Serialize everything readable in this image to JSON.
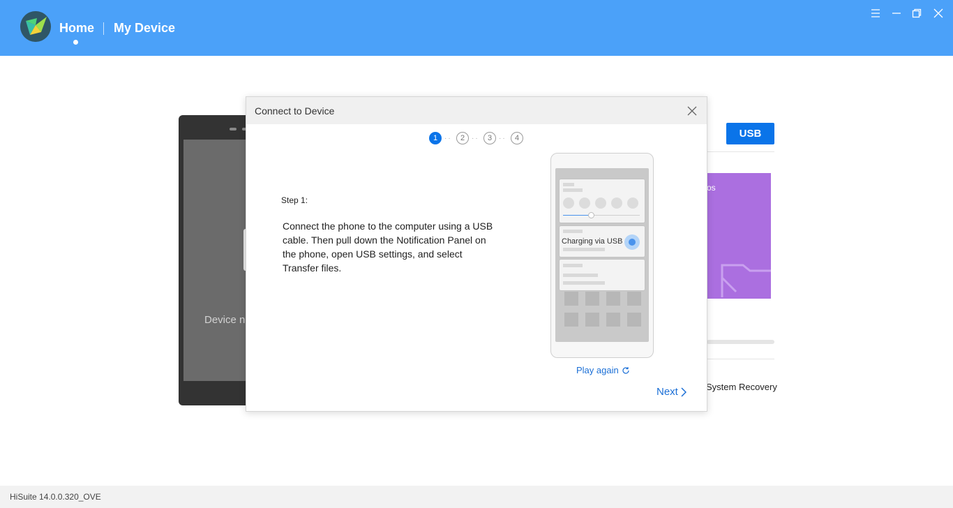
{
  "header": {
    "nav_home": "Home",
    "nav_device": "My Device",
    "background_color": "#4ba1f9"
  },
  "background": {
    "device_status_text": "Device no",
    "usb_button_label": "USB",
    "card_partial_text": "os",
    "system_recovery": "System Recovery"
  },
  "dialog": {
    "title": "Connect to Device",
    "steps": [
      "1",
      "2",
      "3",
      "4"
    ],
    "active_step": 1,
    "step_label": "Step 1:",
    "step_description": "Connect the phone to the computer using a USB cable. Then pull down the Notification Panel on the phone, open USB settings, and select Transfer files.",
    "illustration": {
      "charging_text": "Charging via USB"
    },
    "play_again": "Play again",
    "next": "Next",
    "accent_color": "#0a74e9"
  },
  "footer": {
    "version": "HiSuite 14.0.0.320_OVE"
  },
  "icons": [
    "app-logo-icon",
    "menu-icon",
    "minimize-icon",
    "restore-icon",
    "close-icon",
    "refresh-icon",
    "chevron-right-icon",
    "folder-icon"
  ]
}
